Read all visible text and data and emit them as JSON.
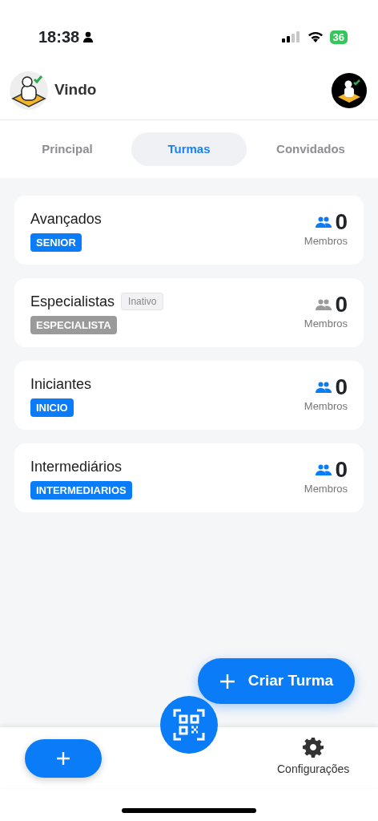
{
  "status_bar": {
    "time": "18:38",
    "battery": "36"
  },
  "header": {
    "title": "Vindo"
  },
  "tabs": [
    {
      "label": "Principal",
      "selected": false
    },
    {
      "label": "Turmas",
      "selected": true
    },
    {
      "label": "Convidados",
      "selected": false
    }
  ],
  "groups": [
    {
      "name": "Avançados",
      "tag": "SENIOR",
      "active": true,
      "count": "0",
      "count_label": "Membros"
    },
    {
      "name": "Especialistas",
      "status_badge": "Inativo",
      "tag": "ESPECIALISTA",
      "active": false,
      "count": "0",
      "count_label": "Membros"
    },
    {
      "name": "Iniciantes",
      "tag": "INICIO",
      "active": true,
      "count": "0",
      "count_label": "Membros"
    },
    {
      "name": "Intermediários",
      "tag": "INTERMEDIARIOS",
      "active": true,
      "count": "0",
      "count_label": "Membros"
    }
  ],
  "fab": {
    "label": "Criar Turma"
  },
  "bottom_bar": {
    "settings_label": "Configurações"
  }
}
